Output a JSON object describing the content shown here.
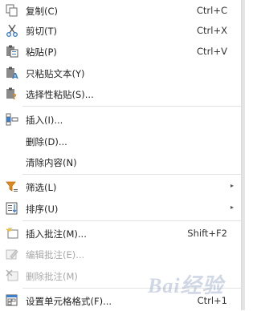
{
  "menu": {
    "copy": {
      "label": "复制(C)",
      "shortcut": "Ctrl+C",
      "icon": "copy-icon"
    },
    "cut": {
      "label": "剪切(T)",
      "shortcut": "Ctrl+X",
      "icon": "scissors-icon"
    },
    "paste": {
      "label": "粘贴(P)",
      "shortcut": "Ctrl+V",
      "icon": "paste-icon"
    },
    "paste_text": {
      "label": "只粘贴文本(Y)",
      "icon": "paste-text-icon"
    },
    "paste_special": {
      "label": "选择性粘贴(S)...",
      "icon": "paste-special-icon"
    },
    "insert": {
      "label": "插入(I)...",
      "icon": "insert-cells-icon"
    },
    "delete": {
      "label": "删除(D)..."
    },
    "clear": {
      "label": "清除内容(N)"
    },
    "filter": {
      "label": "筛选(L)",
      "icon": "filter-icon"
    },
    "sort": {
      "label": "排序(U)",
      "icon": "sort-icon"
    },
    "insert_comment": {
      "label": "插入批注(M)...",
      "shortcut": "Shift+F2",
      "icon": "comment-add-icon"
    },
    "edit_comment": {
      "label": "编辑批注(E)...",
      "icon": "comment-edit-icon",
      "disabled": true
    },
    "delete_comment": {
      "label": "删除批注(M)",
      "icon": "comment-delete-icon",
      "disabled": true
    },
    "format_cells": {
      "label": "设置单元格格式(F)...",
      "shortcut": "Ctrl+1",
      "icon": "format-cells-icon"
    }
  },
  "watermark": "Bai经验",
  "colors": {
    "accent_blue": "#3f7fc6",
    "disabled_text": "#a8a8a8",
    "separator": "#e2e2e2"
  }
}
